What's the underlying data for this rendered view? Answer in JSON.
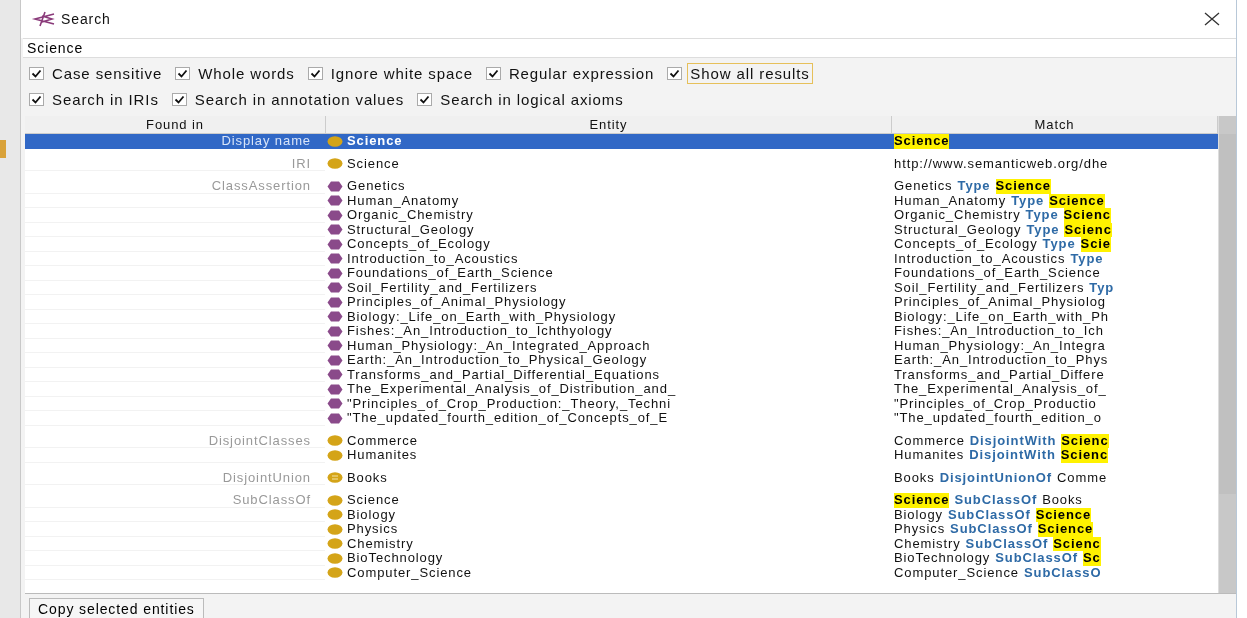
{
  "window": {
    "title": "Search"
  },
  "search": {
    "value": "Science"
  },
  "options": [
    {
      "label": "Case sensitive",
      "checked": true,
      "focused": false
    },
    {
      "label": "Whole words",
      "checked": true,
      "focused": false
    },
    {
      "label": "Ignore white space",
      "checked": true,
      "focused": false
    },
    {
      "label": "Regular expression",
      "checked": true,
      "focused": false
    },
    {
      "label": "Show all results",
      "checked": true,
      "focused": true
    },
    {
      "label": "Search in IRIs",
      "checked": true,
      "focused": false
    },
    {
      "label": "Search in annotation values",
      "checked": true,
      "focused": false
    },
    {
      "label": "Search in logical axioms",
      "checked": true,
      "focused": false
    }
  ],
  "table": {
    "columns": [
      "Found in",
      "Entity",
      "Match"
    ],
    "groups": [
      {
        "found_in": "Display name",
        "rows": [
          {
            "entity": "Science",
            "kind": "class",
            "selected": true,
            "match": [
              {
                "text": "Science",
                "kind": "hit"
              }
            ]
          }
        ]
      },
      {
        "found_in": "IRI",
        "rows": [
          {
            "entity": "Science",
            "kind": "class",
            "selected": false,
            "match": [
              {
                "text": "http://www.semanticweb.org/dhe",
                "kind": "plain"
              }
            ]
          }
        ]
      },
      {
        "found_in": "ClassAssertion",
        "rows": [
          {
            "entity": "Genetics",
            "kind": "individual",
            "selected": false,
            "match": [
              {
                "text": "Genetics",
                "kind": "plain"
              },
              {
                "text": "Type",
                "kind": "keyword"
              },
              {
                "text": "Science",
                "kind": "hit"
              }
            ]
          },
          {
            "entity": "Human_Anatomy",
            "kind": "individual",
            "selected": false,
            "match": [
              {
                "text": "Human_Anatomy",
                "kind": "plain"
              },
              {
                "text": "Type",
                "kind": "keyword"
              },
              {
                "text": "Science",
                "kind": "hit"
              }
            ]
          },
          {
            "entity": "Organic_Chemistry",
            "kind": "individual",
            "selected": false,
            "match": [
              {
                "text": "Organic_Chemistry",
                "kind": "plain"
              },
              {
                "text": "Type",
                "kind": "keyword"
              },
              {
                "text": "Scienc",
                "kind": "hit"
              }
            ]
          },
          {
            "entity": "Structural_Geology",
            "kind": "individual",
            "selected": false,
            "match": [
              {
                "text": "Structural_Geology",
                "kind": "plain"
              },
              {
                "text": "Type",
                "kind": "keyword"
              },
              {
                "text": "Scienc",
                "kind": "hit"
              }
            ]
          },
          {
            "entity": "Concepts_of_Ecology",
            "kind": "individual",
            "selected": false,
            "match": [
              {
                "text": "Concepts_of_Ecology",
                "kind": "plain"
              },
              {
                "text": "Type",
                "kind": "keyword"
              },
              {
                "text": "Scie",
                "kind": "hit"
              }
            ]
          },
          {
            "entity": "Introduction_to_Acoustics",
            "kind": "individual",
            "selected": false,
            "match": [
              {
                "text": "Introduction_to_Acoustics",
                "kind": "plain"
              },
              {
                "text": "Type",
                "kind": "keyword"
              }
            ]
          },
          {
            "entity": "Foundations_of_Earth_Science",
            "kind": "individual",
            "selected": false,
            "match": [
              {
                "text": "Foundations_of_Earth_Science",
                "kind": "plain"
              }
            ]
          },
          {
            "entity": "Soil_Fertility_and_Fertilizers",
            "kind": "individual",
            "selected": false,
            "match": [
              {
                "text": "Soil_Fertility_and_Fertilizers",
                "kind": "plain"
              },
              {
                "text": "Typ",
                "kind": "keyword"
              }
            ]
          },
          {
            "entity": "Principles_of_Animal_Physiology",
            "kind": "individual",
            "selected": false,
            "match": [
              {
                "text": "Principles_of_Animal_Physiolog",
                "kind": "plain"
              }
            ]
          },
          {
            "entity": "Biology:_Life_on_Earth_with_Physiology",
            "kind": "individual",
            "selected": false,
            "match": [
              {
                "text": "Biology:_Life_on_Earth_with_Ph",
                "kind": "plain"
              }
            ]
          },
          {
            "entity": "Fishes:_An_Introduction_to_Ichthyology",
            "kind": "individual",
            "selected": false,
            "match": [
              {
                "text": "Fishes:_An_Introduction_to_Ich",
                "kind": "plain"
              }
            ]
          },
          {
            "entity": "Human_Physiology:_An_Integrated_Approach",
            "kind": "individual",
            "selected": false,
            "match": [
              {
                "text": "Human_Physiology:_An_Integra",
                "kind": "plain"
              }
            ]
          },
          {
            "entity": "Earth:_An_Introduction_to_Physical_Geology",
            "kind": "individual",
            "selected": false,
            "match": [
              {
                "text": "Earth:_An_Introduction_to_Phys",
                "kind": "plain"
              }
            ]
          },
          {
            "entity": "Transforms_and_Partial_Differential_Equations",
            "kind": "individual",
            "selected": false,
            "match": [
              {
                "text": "Transforms_and_Partial_Differe",
                "kind": "plain"
              }
            ]
          },
          {
            "entity": "The_Experimental_Analysis_of_Distribution_and_",
            "kind": "individual",
            "selected": false,
            "match": [
              {
                "text": "The_Experimental_Analysis_of_",
                "kind": "plain"
              }
            ]
          },
          {
            "entity": "\"Principles_of_Crop_Production:_Theory,_Techni",
            "kind": "individual",
            "selected": false,
            "match": [
              {
                "text": "\"Principles_of_Crop_Productio",
                "kind": "plain"
              }
            ]
          },
          {
            "entity": "\"The_updated_fourth_edition_of_Concepts_of_E",
            "kind": "individual",
            "selected": false,
            "match": [
              {
                "text": "\"The_updated_fourth_edition_o",
                "kind": "plain"
              }
            ]
          }
        ]
      },
      {
        "found_in": "DisjointClasses",
        "rows": [
          {
            "entity": "Commerce",
            "kind": "class",
            "selected": false,
            "match": [
              {
                "text": "Commerce",
                "kind": "plain"
              },
              {
                "text": "DisjointWith",
                "kind": "keyword"
              },
              {
                "text": "Scienc",
                "kind": "hit"
              }
            ]
          },
          {
            "entity": "Humanites",
            "kind": "class",
            "selected": false,
            "match": [
              {
                "text": "Humanites",
                "kind": "plain"
              },
              {
                "text": "DisjointWith",
                "kind": "keyword"
              },
              {
                "text": "Scienc",
                "kind": "hit"
              }
            ]
          }
        ]
      },
      {
        "found_in": "DisjointUnion",
        "rows": [
          {
            "entity": "Books",
            "kind": "defined-class",
            "selected": false,
            "match": [
              {
                "text": "Books",
                "kind": "plain"
              },
              {
                "text": "DisjointUnionOf",
                "kind": "keyword"
              },
              {
                "text": "Comme",
                "kind": "plain"
              }
            ]
          }
        ]
      },
      {
        "found_in": "SubClassOf",
        "rows": [
          {
            "entity": "Science",
            "kind": "class",
            "selected": false,
            "match": [
              {
                "text": "Science",
                "kind": "hit"
              },
              {
                "text": "SubClassOf",
                "kind": "keyword"
              },
              {
                "text": "Books",
                "kind": "plain"
              }
            ]
          },
          {
            "entity": "Biology",
            "kind": "class",
            "selected": false,
            "match": [
              {
                "text": "Biology",
                "kind": "plain"
              },
              {
                "text": "SubClassOf",
                "kind": "keyword"
              },
              {
                "text": "Science",
                "kind": "hit"
              }
            ]
          },
          {
            "entity": "Physics",
            "kind": "class",
            "selected": false,
            "match": [
              {
                "text": "Physics",
                "kind": "plain"
              },
              {
                "text": "SubClassOf",
                "kind": "keyword"
              },
              {
                "text": "Science",
                "kind": "hit"
              }
            ]
          },
          {
            "entity": "Chemistry",
            "kind": "class",
            "selected": false,
            "match": [
              {
                "text": "Chemistry",
                "kind": "plain"
              },
              {
                "text": "SubClassOf",
                "kind": "keyword"
              },
              {
                "text": "Scienc",
                "kind": "hit"
              }
            ]
          },
          {
            "entity": "BioTechnology",
            "kind": "class",
            "selected": false,
            "match": [
              {
                "text": "BioTechnology",
                "kind": "plain"
              },
              {
                "text": "SubClassOf",
                "kind": "keyword"
              },
              {
                "text": "Sc",
                "kind": "hit"
              }
            ]
          },
          {
            "entity": "Computer_Science",
            "kind": "class",
            "selected": false,
            "match": [
              {
                "text": "Computer_Science",
                "kind": "plain"
              },
              {
                "text": "SubClassO",
                "kind": "keyword"
              }
            ]
          }
        ]
      }
    ]
  },
  "buttons": [
    "Copy selected entities"
  ]
}
